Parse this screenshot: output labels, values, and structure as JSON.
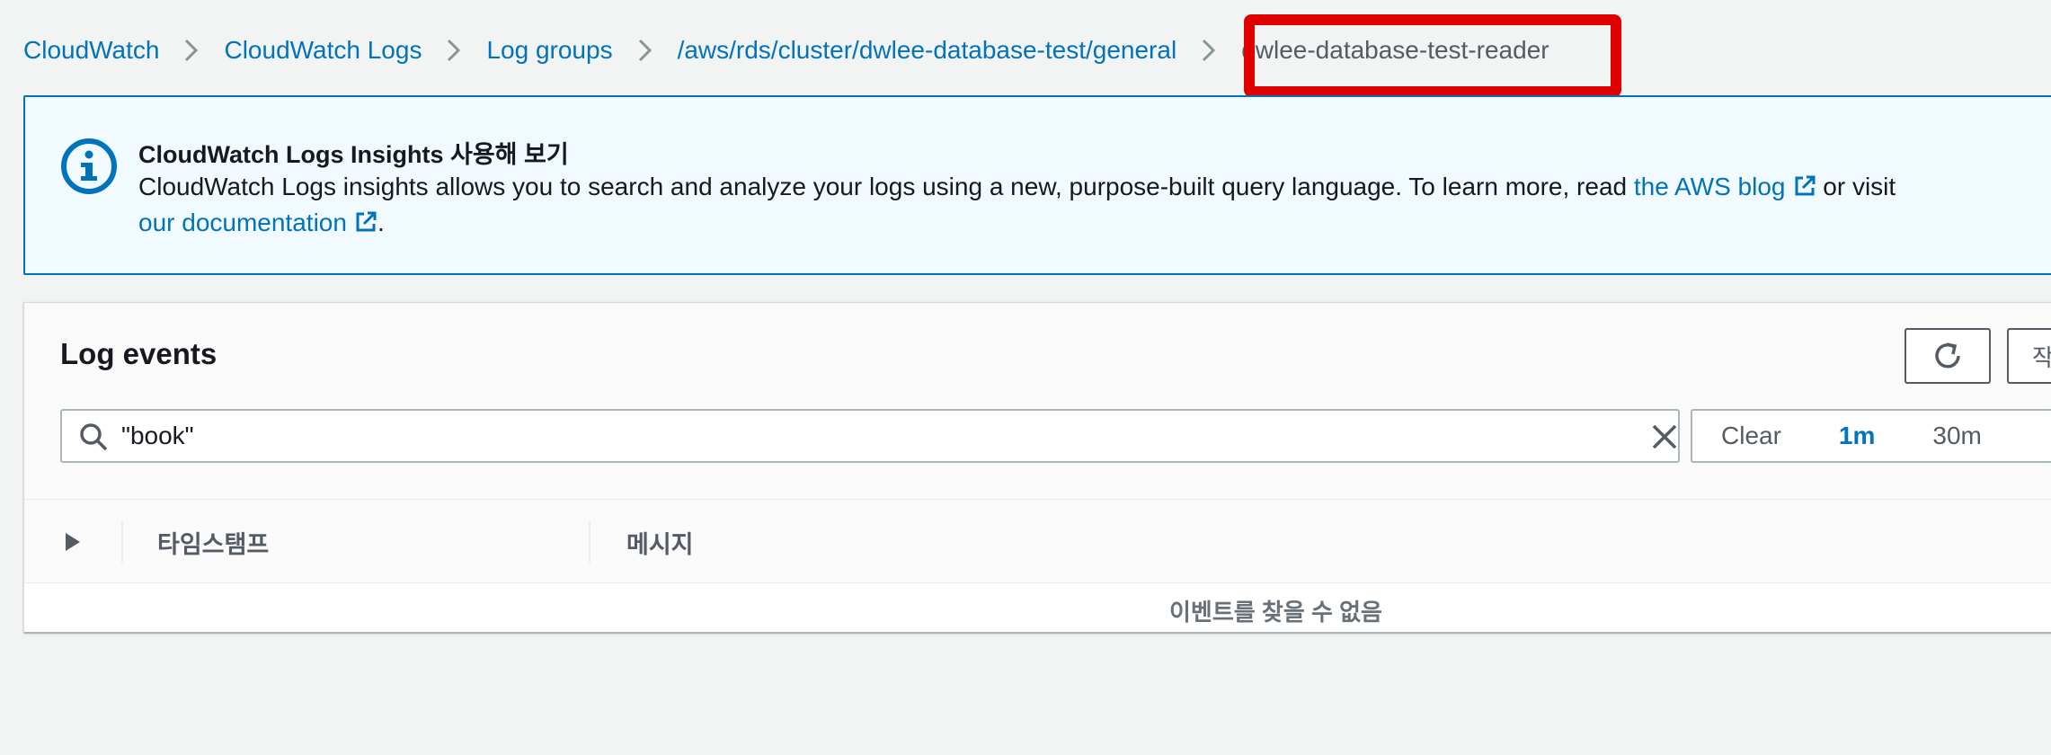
{
  "breadcrumb": {
    "items": [
      {
        "label": "CloudWatch"
      },
      {
        "label": "CloudWatch Logs"
      },
      {
        "label": "Log groups"
      },
      {
        "label": "/aws/rds/cluster/dwlee-database-test/general"
      }
    ],
    "current": "dwlee-database-test-reader"
  },
  "banner": {
    "title": "CloudWatch Logs Insights 사용해 보기",
    "body_prefix": "CloudWatch Logs insights allows you to search and analyze your logs using a new, purpose-built query language. To learn more, read ",
    "link_blog": "the AWS blog",
    "body_middle": " or visit ",
    "link_docs": "our documentation",
    "body_suffix": "."
  },
  "log_events": {
    "title": "Log events",
    "action_button_partial": "작",
    "search": {
      "value": "\"book\""
    },
    "time_range": {
      "clear_label": "Clear",
      "options": [
        "1m",
        "30m"
      ],
      "active": "1m"
    },
    "table": {
      "columns": [
        "타임스탬프",
        "메시지"
      ],
      "empty_message": "이벤트를 찾을 수 없음"
    }
  },
  "colors": {
    "link": "#0073bb",
    "highlight": "#e10000",
    "banner_bg": "#f1faff",
    "page_bg": "#f2f3f3"
  }
}
